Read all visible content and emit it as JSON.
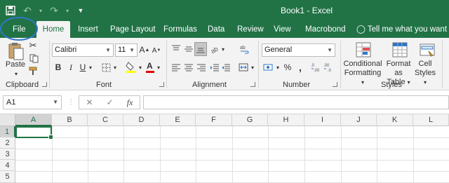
{
  "window": {
    "title": "Book1  -  Excel"
  },
  "quick_access": {
    "save_icon": "save-icon",
    "undo_icon": "undo-icon",
    "redo_icon": "redo-icon",
    "customize_icon": "customize-qat-icon"
  },
  "tabs": [
    {
      "label": "File"
    },
    {
      "label": "Home"
    },
    {
      "label": "Insert"
    },
    {
      "label": "Page Layout"
    },
    {
      "label": "Formulas"
    },
    {
      "label": "Data"
    },
    {
      "label": "Review"
    },
    {
      "label": "View"
    },
    {
      "label": "Macrobond"
    }
  ],
  "tell_me": {
    "text": "Tell me what you want to do"
  },
  "ribbon": {
    "clipboard": {
      "label": "Clipboard",
      "paste": "Paste"
    },
    "font": {
      "label": "Font",
      "name": "Calibri",
      "size": "11",
      "bold": "B",
      "italic": "I",
      "underline": "U",
      "grow": "A",
      "shrink": "A"
    },
    "alignment": {
      "label": "Alignment"
    },
    "number": {
      "label": "Number",
      "format": "General",
      "currency": "$",
      "percent": "%",
      "comma": ","
    },
    "styles": {
      "label": "Styles",
      "conditional": [
        "Conditional",
        "Formatting"
      ],
      "format_table": [
        "Format as",
        "Table"
      ],
      "cell_styles": [
        "Cell",
        "Styles"
      ]
    }
  },
  "formula_bar": {
    "name_box": "A1",
    "value": "",
    "fx": "fx"
  },
  "grid": {
    "columns": [
      "A",
      "B",
      "C",
      "D",
      "E",
      "F",
      "G",
      "H",
      "I",
      "J",
      "K",
      "L"
    ],
    "rows": [
      "1",
      "2",
      "3",
      "4",
      "5"
    ],
    "selected_cell": "A1"
  },
  "colors": {
    "accent": "#217346",
    "highlight_circle": "#2f76c9",
    "fill_yellow": "#ffff00",
    "font_red": "#e00000"
  }
}
